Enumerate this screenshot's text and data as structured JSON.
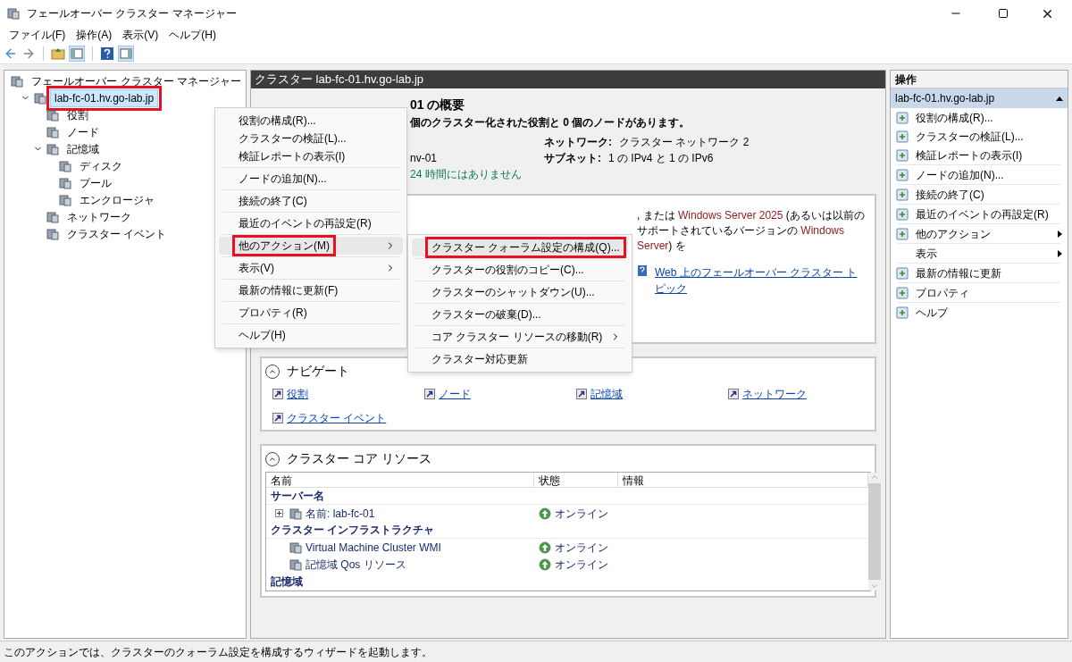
{
  "window": {
    "title": "フェールオーバー クラスター マネージャー"
  },
  "menu_bar": [
    "ファイル(F)",
    "操作(A)",
    "表示(V)",
    "ヘルプ(H)"
  ],
  "tree": [
    {
      "label": "フェールオーバー クラスター マネージャー",
      "children": [
        {
          "label": "lab-fc-01.hv.go-lab.jp",
          "expanded": true,
          "selected": true,
          "highlighted": true,
          "children": [
            {
              "label": "役割",
              "selected": false,
              "highlighted": false
            },
            {
              "label": "ノード",
              "selected": false,
              "highlighted": false
            },
            {
              "label": "記憶域",
              "expanded": true,
              "selected": false,
              "highlighted": false,
              "children": [
                {
                  "label": "ディスク",
                  "selected": false,
                  "highlighted": false
                },
                {
                  "label": "プール",
                  "selected": false,
                  "highlighted": false
                },
                {
                  "label": "エンクロージャ",
                  "selected": false,
                  "highlighted": false
                }
              ]
            },
            {
              "label": "ネットワーク",
              "selected": false,
              "highlighted": false
            },
            {
              "label": "クラスター イベント",
              "selected": false,
              "highlighted": false
            }
          ]
        }
      ]
    }
  ],
  "header": "クラスター lab-fc-01.hv.go-lab.jp",
  "summary": {
    "title": "01 の概要",
    "subtitle": "個のクラスター化された役割と 0 個のノードがあります。",
    "left_lines": [
      {
        "text": "nv-01",
        "status": false
      },
      {
        "text": "24 時間にはありません",
        "status": true
      }
    ],
    "fields": [
      {
        "label": "ネットワーク:",
        "value": "クラスター ネットワーク 2"
      },
      {
        "label": "サブネット:",
        "value": "1 の IPv4 と 1 の IPv6"
      }
    ]
  },
  "config_box": {
    "text_parts": [
      {
        "text": ", または ",
        "emphasis": false
      },
      {
        "text": "Windows Server 2025",
        "emphasis": true
      },
      {
        "text": " (あるいは以前のサポートされているバージョンの ",
        "emphasis": false
      },
      {
        "text": "Windows Server",
        "emphasis": true
      },
      {
        "text": ") を",
        "emphasis": false
      }
    ],
    "link": "Web 上のフェールオーバー クラスター トピック"
  },
  "navigate": {
    "title": "ナビゲート",
    "expanded": true,
    "links": [
      "役割",
      "ノード",
      "記憶域",
      "ネットワーク",
      "クラスター イベント"
    ]
  },
  "core_resources": {
    "title": "クラスター コア リソース",
    "expanded": true,
    "columns": [
      "名前",
      "状態",
      "情報"
    ],
    "rows": [
      {
        "kind": "group",
        "name": "サーバー名"
      },
      {
        "kind": "resource",
        "name": "名前: lab-fc-01",
        "status": "オンライン",
        "expandable": true
      },
      {
        "kind": "group",
        "name": "クラスター インフラストラクチャ"
      },
      {
        "kind": "resource",
        "name": "Virtual Machine Cluster WMI",
        "status": "オンライン",
        "expandable": false
      },
      {
        "kind": "resource",
        "name": "記憶域 Qos リソース",
        "status": "オンライン",
        "expandable": false
      },
      {
        "kind": "group",
        "name": "記憶域"
      }
    ]
  },
  "actions": {
    "title": "操作",
    "group": "lab-fc-01.hv.go-lab.jp",
    "group_expanded": true,
    "items": [
      {
        "label": "役割の構成(R)...",
        "has_icon": true,
        "divider_before": false,
        "has_submenu": false
      },
      {
        "label": "クラスターの検証(L)...",
        "has_icon": true,
        "divider_before": false,
        "has_submenu": false
      },
      {
        "label": "検証レポートの表示(I)",
        "has_icon": true,
        "divider_before": false,
        "has_submenu": false
      },
      {
        "label": "ノードの追加(N)...",
        "has_icon": true,
        "divider_before": true,
        "has_submenu": false
      },
      {
        "label": "接続の終了(C)",
        "has_icon": true,
        "divider_before": true,
        "has_submenu": false
      },
      {
        "label": "最近のイベントの再設定(R)",
        "has_icon": true,
        "divider_before": true,
        "has_submenu": false
      },
      {
        "label": "他のアクション",
        "has_icon": true,
        "divider_before": true,
        "has_submenu": true
      },
      {
        "label": "表示",
        "has_icon": false,
        "divider_before": true,
        "has_submenu": true
      },
      {
        "label": "最新の情報に更新",
        "has_icon": true,
        "divider_before": true,
        "has_submenu": false
      },
      {
        "label": "プロパティ",
        "has_icon": true,
        "divider_before": true,
        "has_submenu": false
      },
      {
        "label": "ヘルプ",
        "has_icon": true,
        "divider_before": true,
        "has_submenu": false
      }
    ]
  },
  "context_menu": [
    {
      "label": "役割の構成(R)...",
      "divider_before": false,
      "has_submenu": false,
      "selected": false,
      "highlighted": false
    },
    {
      "label": "クラスターの検証(L)...",
      "divider_before": false,
      "has_submenu": false,
      "selected": false,
      "highlighted": false
    },
    {
      "label": "検証レポートの表示(I)",
      "divider_before": false,
      "has_submenu": false,
      "selected": false,
      "highlighted": false
    },
    {
      "label": "ノードの追加(N)...",
      "divider_before": true,
      "has_submenu": false,
      "selected": false,
      "highlighted": false
    },
    {
      "label": "接続の終了(C)",
      "divider_before": true,
      "has_submenu": false,
      "selected": false,
      "highlighted": false
    },
    {
      "label": "最近のイベントの再設定(R)",
      "divider_before": true,
      "has_submenu": false,
      "selected": false,
      "highlighted": false
    },
    {
      "label": "他のアクション(M)",
      "divider_before": true,
      "has_submenu": true,
      "selected": true,
      "highlighted": true
    },
    {
      "label": "表示(V)",
      "divider_before": true,
      "has_submenu": true,
      "selected": false,
      "highlighted": false
    },
    {
      "label": "最新の情報に更新(F)",
      "divider_before": true,
      "has_submenu": false,
      "selected": false,
      "highlighted": false
    },
    {
      "label": "プロパティ(R)",
      "divider_before": true,
      "has_submenu": false,
      "selected": false,
      "highlighted": false
    },
    {
      "label": "ヘルプ(H)",
      "divider_before": true,
      "has_submenu": false,
      "selected": false,
      "highlighted": false
    }
  ],
  "submenu": [
    {
      "label": "クラスター クォーラム設定の構成(Q)...",
      "divider_before": false,
      "has_submenu": false,
      "selected": true,
      "highlighted": true
    },
    {
      "label": "クラスターの役割のコピー(C)...",
      "divider_before": true,
      "has_submenu": false,
      "selected": false,
      "highlighted": false
    },
    {
      "label": "クラスターのシャットダウン(U)...",
      "divider_before": true,
      "has_submenu": false,
      "selected": false,
      "highlighted": false
    },
    {
      "label": "クラスターの破棄(D)...",
      "divider_before": true,
      "has_submenu": false,
      "selected": false,
      "highlighted": false
    },
    {
      "label": "コア クラスター リソースの移動(R)",
      "divider_before": true,
      "has_submenu": true,
      "selected": false,
      "highlighted": false
    },
    {
      "label": "クラスター対応更新",
      "divider_before": true,
      "has_submenu": false,
      "selected": false,
      "highlighted": false
    }
  ],
  "status_bar": "このアクションでは、クラスターのクォーラム設定を構成するウィザードを起動します。"
}
